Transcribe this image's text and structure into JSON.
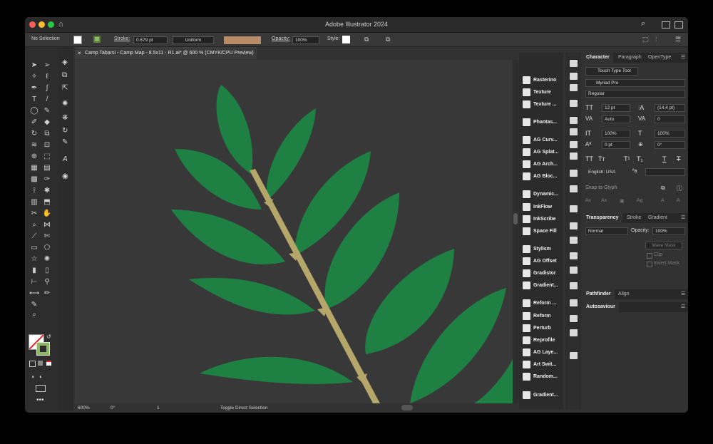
{
  "window": {
    "title": "Adobe Illustrator 2024"
  },
  "control_bar": {
    "selection": "No Selection",
    "stroke_label": "Stroke:",
    "stroke_weight": "0.679 pt",
    "stroke_profile": "Uniform",
    "opacity_label": "Opacity:",
    "opacity_value": "100%",
    "style_label": "Style:"
  },
  "document_tab": {
    "label": "Camp Tabarsi - Camp Map - 8.5x11 - R1.ai* @ 600 % (CMYK/CPU Preview)"
  },
  "status_bar": {
    "zoom": "600%",
    "rotation": "0°",
    "artboard": "1",
    "tool_hint": "Toggle Direct Selection"
  },
  "plugins": [
    "Rasterino",
    "Texture",
    "Texture ...",
    "Phantas...",
    "AG Curv...",
    "AG Splat...",
    "AG Arch...",
    "AG Bloc...",
    "Dynamic...",
    "InkFlow",
    "InkScribe",
    "Space Fill",
    "Stylism",
    "AG Offset",
    "Gradistor",
    "Gradient...",
    "Reform ...",
    "Reform",
    "Perturb",
    "Reprofile",
    "AG Laye...",
    "Art Swit...",
    "Random...",
    "Gradient..."
  ],
  "character_panel": {
    "tabs": [
      "Character",
      "Paragraph",
      "OpenType"
    ],
    "touch_type": "Touch Type Tool",
    "font_family": "Myriad Pro",
    "font_style": "Regular",
    "font_size": "12 pt",
    "leading": "(14.4 pt)",
    "kerning": "Auto",
    "tracking": "0",
    "vertical_scale": "100%",
    "horizontal_scale": "100%",
    "baseline_shift": "0 pt",
    "rotation": "0°",
    "language": "English: USA",
    "aa_symbol": "ªa",
    "snap_label": "Snap to Glyph"
  },
  "transparency_panel": {
    "tabs": [
      "Transparency",
      "Stroke",
      "Gradient"
    ],
    "blend_mode": "Normal",
    "opacity_label": "Opacity:",
    "opacity_value": "100%",
    "make_mask": "Make Mask",
    "clip": "Clip",
    "invert_mask": "Invert Mask"
  },
  "pathfinder_panel": {
    "tabs": [
      "Pathfinder",
      "Align"
    ]
  },
  "autosaviour_panel": {
    "title": "Autosaviour"
  },
  "colors": {
    "leaf": "#1e8143",
    "stem": "#b5a669",
    "canvas": "#383838"
  }
}
